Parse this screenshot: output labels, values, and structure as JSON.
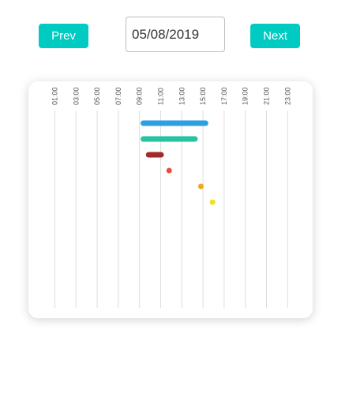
{
  "controls": {
    "prev_label": "Prev",
    "next_label": "Next",
    "date_value": "05/08/2019",
    "accent_color": "#00cbc3"
  },
  "timeline": {
    "hours": [
      "01:00",
      "03:00",
      "05:00",
      "07:00",
      "09:00",
      "11:00",
      "13:00",
      "15:00",
      "17:00",
      "19:00",
      "21:00",
      "23:00"
    ],
    "events": [
      {
        "start": 9.1,
        "end": 15.5,
        "color": "#2b9ee6",
        "kind": "bar"
      },
      {
        "start": 9.1,
        "end": 14.5,
        "color": "#27c3a0",
        "kind": "bar"
      },
      {
        "start": 9.6,
        "end": 11.3,
        "color": "#a22a28",
        "kind": "bar"
      },
      {
        "start": 11.8,
        "end": 11.8,
        "color": "#e84c3d",
        "kind": "dot"
      },
      {
        "start": 14.8,
        "end": 14.8,
        "color": "#f0a818",
        "kind": "dot"
      },
      {
        "start": 15.9,
        "end": 15.9,
        "color": "#f1e21a",
        "kind": "dot"
      }
    ]
  }
}
